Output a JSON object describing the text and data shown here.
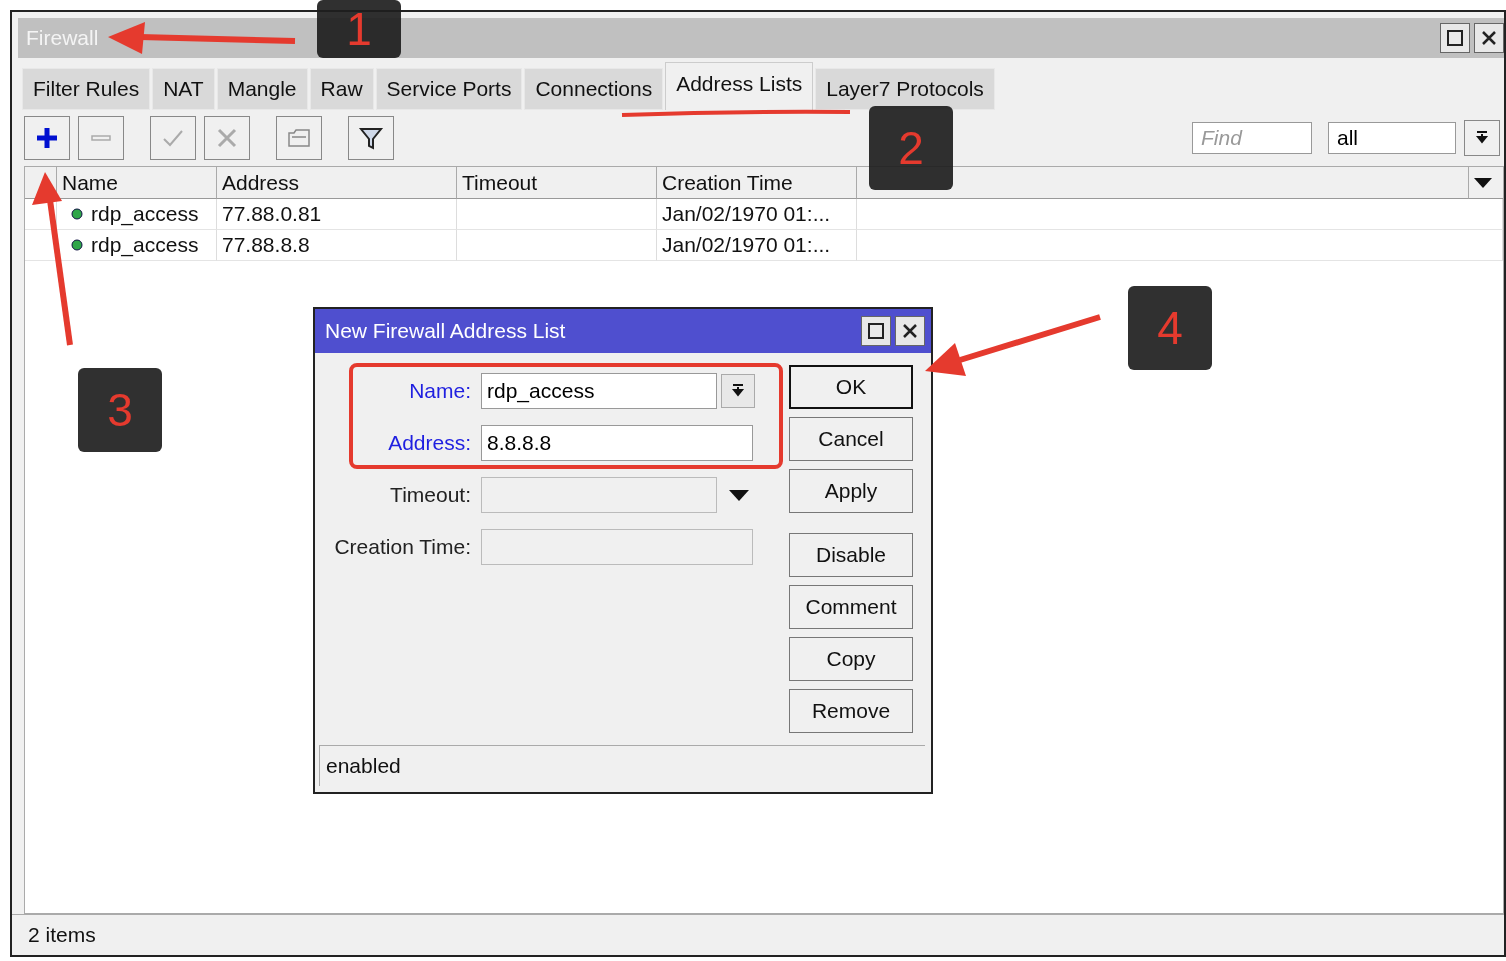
{
  "window": {
    "title": "Firewall"
  },
  "tabs": [
    {
      "label": "Filter Rules",
      "selected": false
    },
    {
      "label": "NAT",
      "selected": false
    },
    {
      "label": "Mangle",
      "selected": false
    },
    {
      "label": "Raw",
      "selected": false
    },
    {
      "label": "Service Ports",
      "selected": false
    },
    {
      "label": "Connections",
      "selected": false
    },
    {
      "label": "Address Lists",
      "selected": true
    },
    {
      "label": "Layer7 Protocols",
      "selected": false
    }
  ],
  "toolbar": {
    "find": {
      "placeholder": "Find"
    },
    "filter": {
      "value": "all"
    }
  },
  "table": {
    "columns": [
      "Name",
      "Address",
      "Timeout",
      "Creation Time"
    ],
    "rows": [
      {
        "name": "rdp_access",
        "address": "77.88.0.81",
        "creation_time": "Jan/02/1970 01:..."
      },
      {
        "name": "rdp_access",
        "address": "77.88.8.8",
        "creation_time": "Jan/02/1970 01:..."
      }
    ]
  },
  "dialog": {
    "title": "New Firewall Address List",
    "fields": [
      {
        "label": "Name:",
        "value": "rdp_access",
        "kind": "combo",
        "required": true
      },
      {
        "label": "Address:",
        "value": "8.8.8.8",
        "kind": "text",
        "required": true
      },
      {
        "label": "Timeout:",
        "kind": "dropdown",
        "required": false
      },
      {
        "label": "Creation Time:",
        "kind": "text",
        "required": false
      }
    ],
    "button_groups": [
      [
        {
          "label": "OK",
          "default": true
        },
        {
          "label": "Cancel",
          "default": false
        },
        {
          "label": "Apply",
          "default": false
        }
      ],
      [
        {
          "label": "Disable",
          "default": false
        },
        {
          "label": "Comment",
          "default": false
        },
        {
          "label": "Copy",
          "default": false
        },
        {
          "label": "Remove",
          "default": false
        }
      ]
    ],
    "status": "enabled"
  },
  "status_bar": "2 items",
  "annotations": [
    "1",
    "2",
    "3",
    "4"
  ]
}
